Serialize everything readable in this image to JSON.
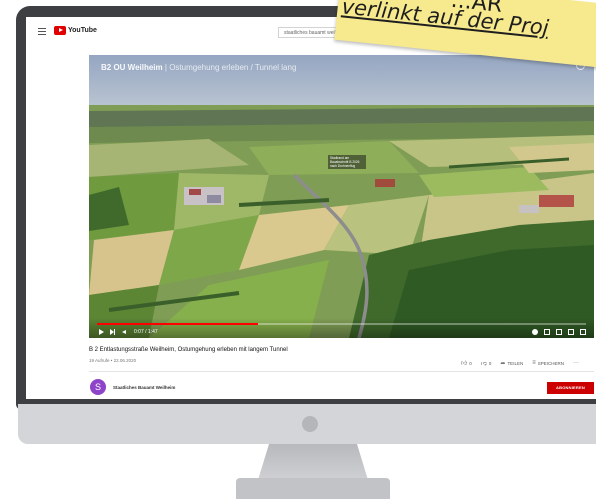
{
  "header": {
    "logo_text": "YouTube",
    "search_value": "staatliches bauamt weilheim"
  },
  "video": {
    "overlay_title": "B2 OU Weilheim",
    "overlay_subtitle": "| Ostumgehung erleben / Tunnel lang",
    "overlay_label": "Stadtrand am Bauabschnitt B 2026 nach Drohnenflug",
    "time": "0:07 / 1:47",
    "progress": 0.33
  },
  "details": {
    "title": "B 2 Entlastungsstraße Weilheim, Ostumgehung erleben mit langem Tunnel",
    "meta": "19 Aufrufe • 22.06.2020",
    "likes": "0",
    "dislikes": "0",
    "share_label": "TEILEN",
    "save_label": "SPEICHERN"
  },
  "channel": {
    "avatar_letter": "S",
    "name": "Staatliches Bauamt Weilheim",
    "subscribe_label": "ABONNIEREN",
    "avatar_color": "#8e44c9",
    "subscribe_color": "#cc0000"
  },
  "note": {
    "line1": "...AR",
    "line2": "verlinkt auf der Proj"
  }
}
